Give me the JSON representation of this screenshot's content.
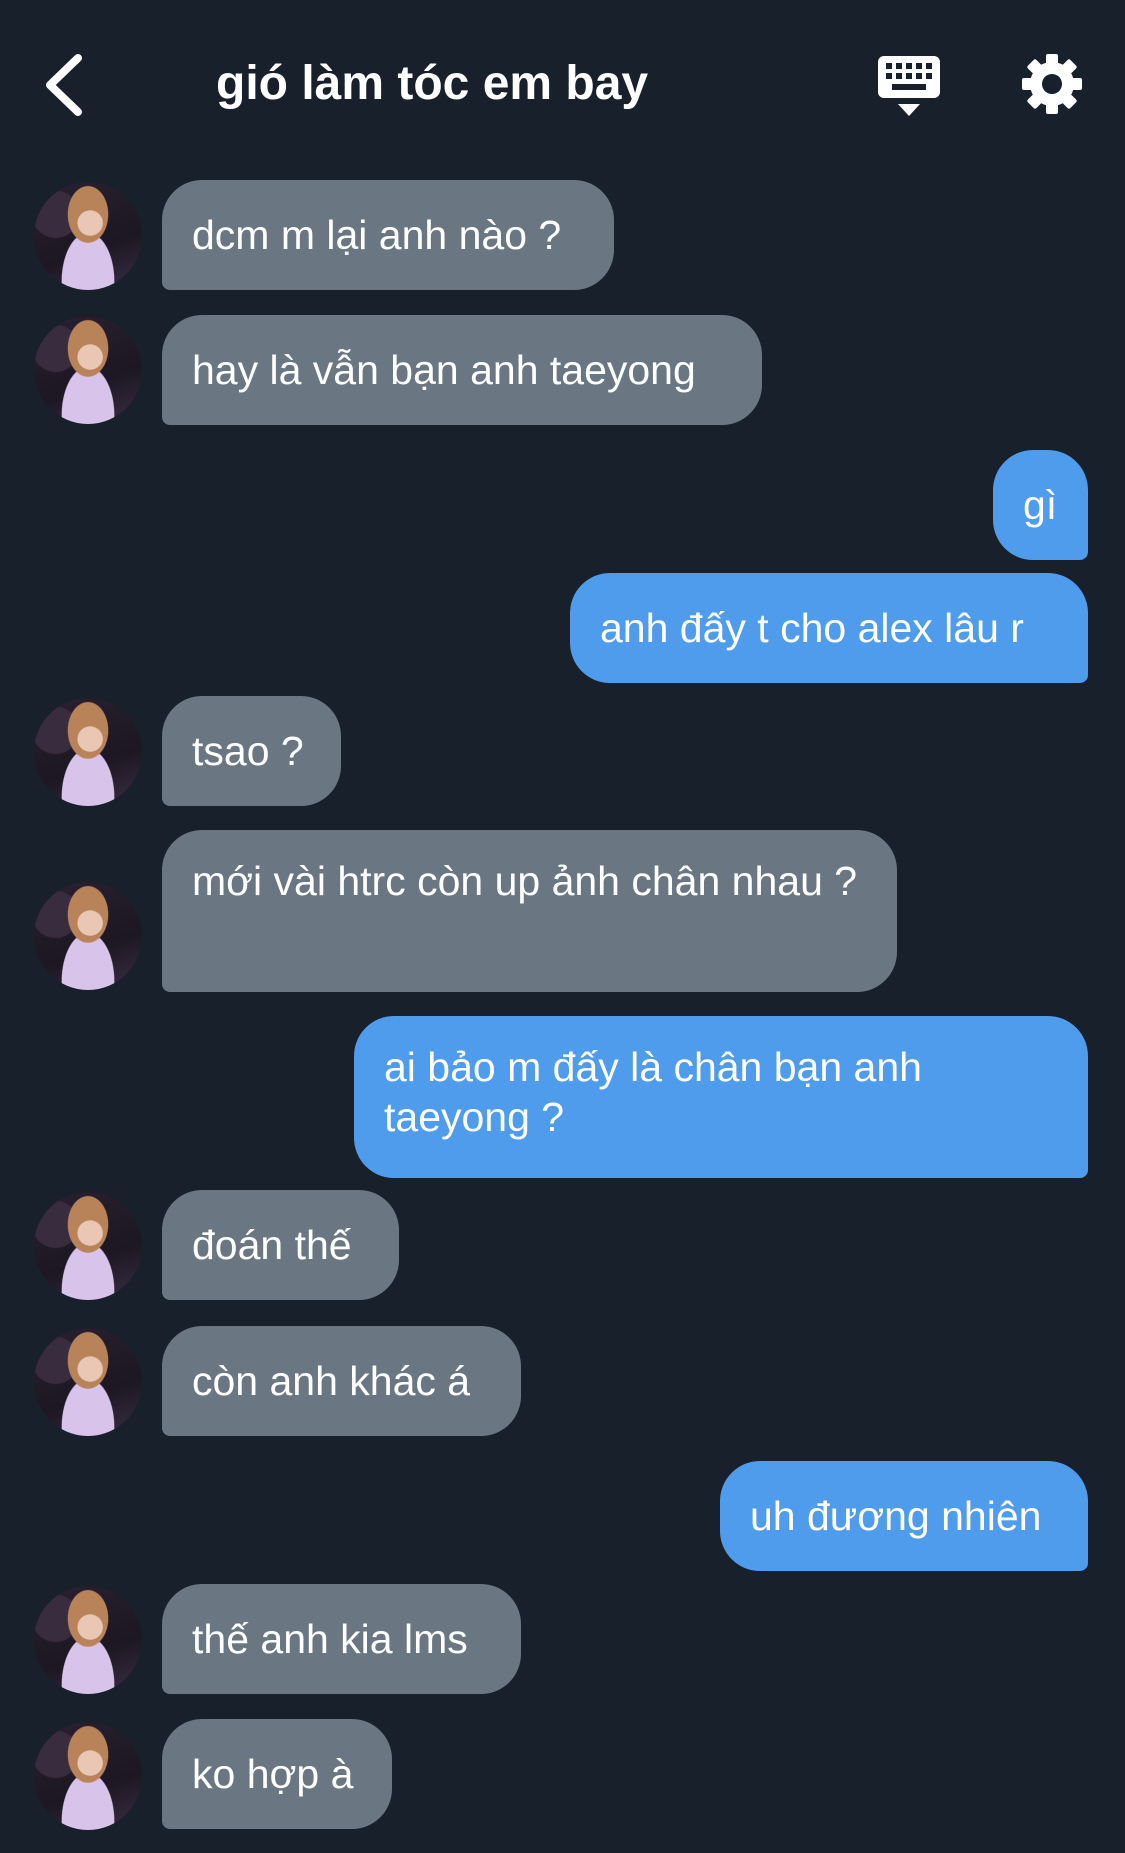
{
  "header": {
    "title": "gió làm tóc em bay",
    "back_icon": "chevron-left-icon",
    "keyboard_icon": "keyboard-icon",
    "settings_icon": "gear-icon"
  },
  "colors": {
    "background": "#17202b",
    "incoming_bubble": "#6a7782",
    "outgoing_bubble": "#4e9ceb",
    "text": "#ffffff"
  },
  "messages": [
    {
      "side": "in",
      "text": "dcm m lại anh nào ?"
    },
    {
      "side": "in",
      "text": "hay là vẫn bạn anh taeyong"
    },
    {
      "side": "out",
      "text": "gì"
    },
    {
      "side": "out",
      "text": "anh đấy t cho alex lâu r"
    },
    {
      "side": "in",
      "text": "tsao ?"
    },
    {
      "side": "in",
      "text": "mới vài htrc còn up ảnh chân nhau ?"
    },
    {
      "side": "out",
      "text": "ai bảo m đấy là chân bạn anh taeyong ?"
    },
    {
      "side": "in",
      "text": "đoán thế"
    },
    {
      "side": "in",
      "text": "còn anh khác á"
    },
    {
      "side": "out",
      "text": "uh đương nhiên"
    },
    {
      "side": "in",
      "text": "thế anh kia lms"
    },
    {
      "side": "in",
      "text": "ko hợp à"
    }
  ]
}
